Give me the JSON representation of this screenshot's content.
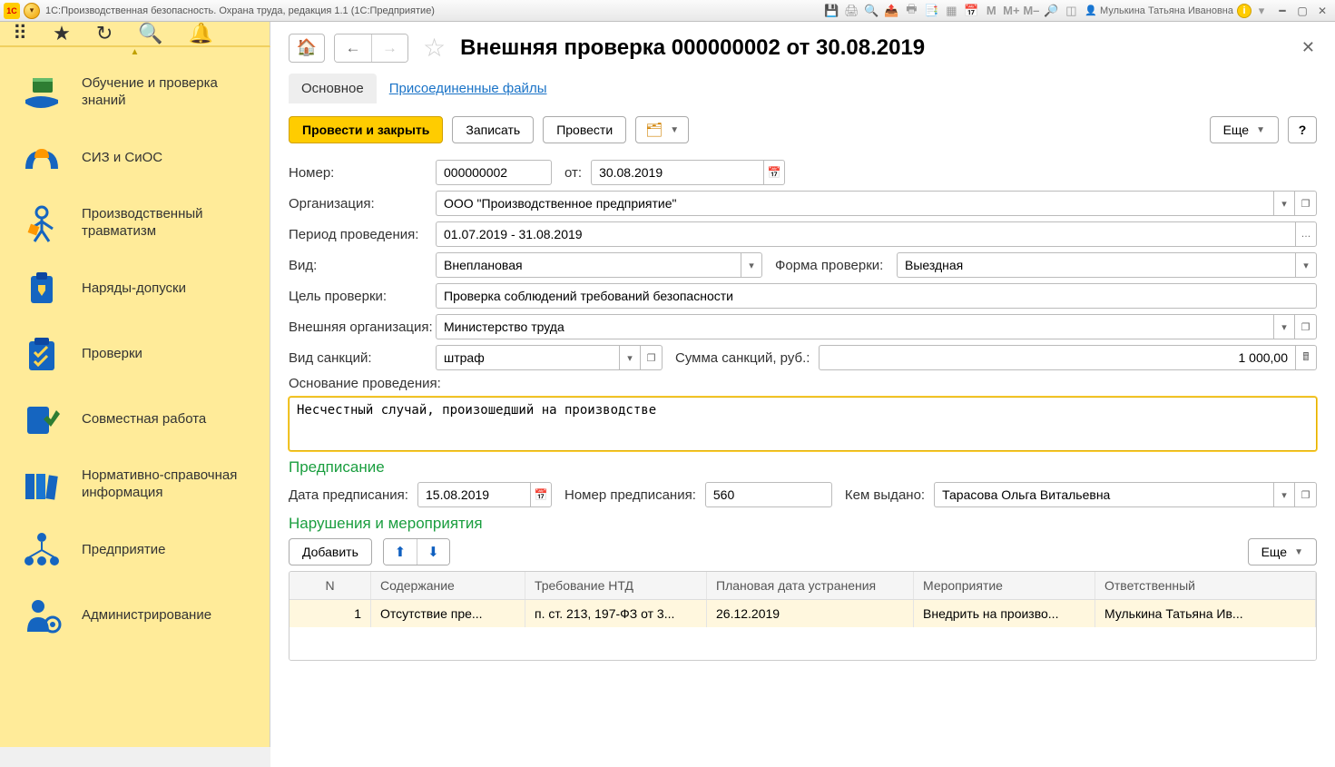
{
  "titlebar": {
    "title": "1С:Производственная безопасность. Охрана труда, редакция 1.1  (1С:Предприятие)",
    "text_marks": {
      "m": "M",
      "mplus": "M+",
      "mminus": "M–"
    },
    "user": "Мулькина Татьяна Ивановна"
  },
  "sidebar": {
    "items": [
      {
        "label": "Обучение и проверка знаний"
      },
      {
        "label": "СИЗ и СиОС"
      },
      {
        "label": "Производственный травматизм"
      },
      {
        "label": "Наряды-допуски"
      },
      {
        "label": "Проверки"
      },
      {
        "label": "Совместная работа"
      },
      {
        "label": "Нормативно-справочная информация"
      },
      {
        "label": "Предприятие"
      },
      {
        "label": "Администрирование"
      }
    ]
  },
  "document": {
    "title": "Внешняя проверка 000000002 от 30.08.2019",
    "tabs": {
      "main": "Основное",
      "files": "Присоединенные файлы"
    },
    "buttons": {
      "post_close": "Провести и закрыть",
      "write": "Записать",
      "post": "Провести",
      "more": "Еще",
      "help": "?",
      "add": "Добавить"
    },
    "labels": {
      "number": "Номер:",
      "from": "от:",
      "org": "Организация:",
      "period": "Период проведения:",
      "kind": "Вид:",
      "form": "Форма проверки:",
      "goal": "Цель проверки:",
      "ext_org": "Внешняя организация:",
      "sanction_kind": "Вид санкций:",
      "sanction_sum": "Сумма санкций, руб.:",
      "basis": "Основание проведения:",
      "order_date": "Дата предписания:",
      "order_no": "Номер предписания:",
      "issued_by": "Кем выдано:"
    },
    "values": {
      "number": "000000002",
      "date": "30.08.2019",
      "org": "ООО \"Производственное предприятие\"",
      "period": "01.07.2019 - 31.08.2019",
      "kind": "Внеплановая",
      "form": "Выездная",
      "goal": "Проверка соблюдений требований безопасности",
      "ext_org": "Министерство труда",
      "sanction_kind": "штраф",
      "sanction_sum": "1 000,00",
      "basis": "Несчестный случай, произошедший на производстве",
      "order_date": "15.08.2019",
      "order_no": "560",
      "issued_by": "Тарасова Ольга Витальевна"
    },
    "sections": {
      "order": "Предписание",
      "violations": "Нарушения и мероприятия"
    },
    "table": {
      "cols": {
        "n": "N",
        "c": "Содержание",
        "t": "Требование НТД",
        "d": "Плановая дата устранения",
        "m": "Мероприятие",
        "o": "Ответственный"
      },
      "rows": [
        {
          "n": "1",
          "c": "Отсутствие пре...",
          "t": "п. ст. 213, 197-ФЗ от 3...",
          "d": "26.12.2019",
          "m": "Внедрить на произво...",
          "o": "Мулькина Татьяна Ив..."
        }
      ]
    }
  }
}
